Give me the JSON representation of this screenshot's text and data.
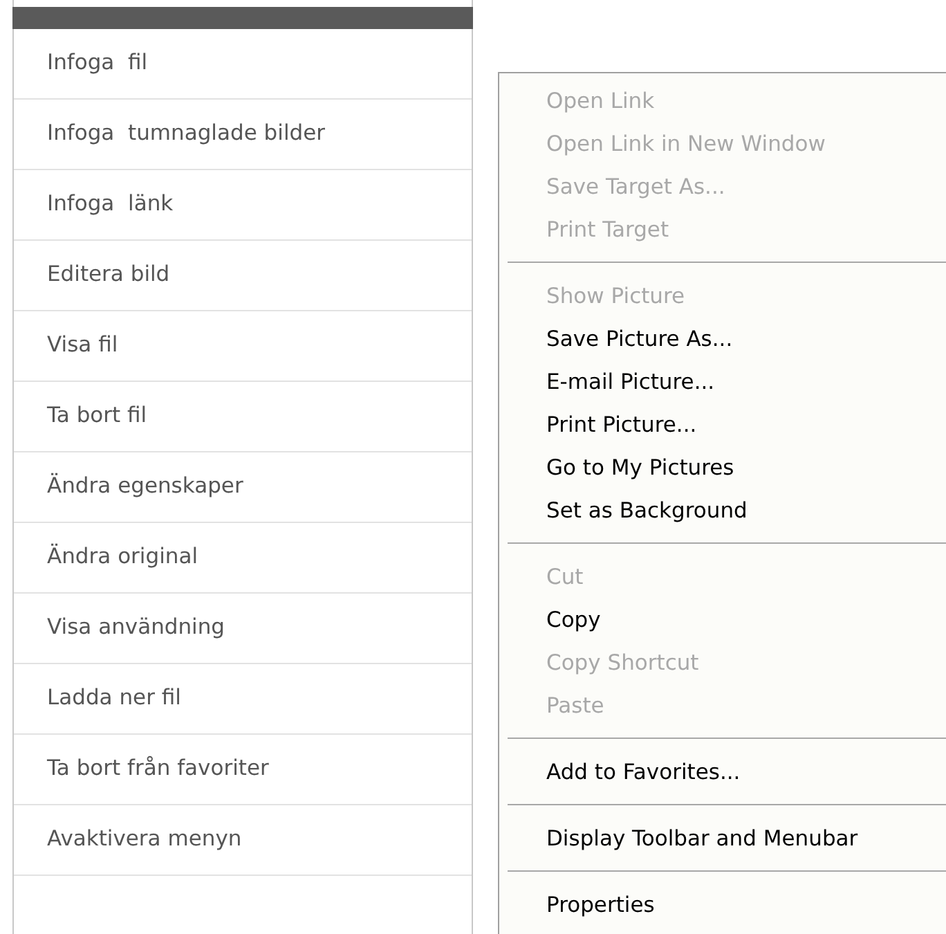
{
  "left_menu": {
    "items": [
      {
        "label": "Infoga  fil"
      },
      {
        "label": "Infoga  tumnaglade bilder"
      },
      {
        "label": "Infoga  länk"
      },
      {
        "label": "Editera bild"
      },
      {
        "label": "Visa fil"
      },
      {
        "label": "Ta bort fil"
      },
      {
        "label": "Ändra egenskaper"
      },
      {
        "label": "Ändra original"
      },
      {
        "label": "Visa användning"
      },
      {
        "label": "Ladda ner fil"
      },
      {
        "label": "Ta bort från favoriter"
      },
      {
        "label": "Avaktivera menyn"
      }
    ]
  },
  "context_menu": {
    "items": [
      {
        "kind": "item",
        "label": "Open Link",
        "disabled": true
      },
      {
        "kind": "item",
        "label": "Open Link in New Window",
        "disabled": true
      },
      {
        "kind": "item",
        "label": "Save Target As...",
        "disabled": true
      },
      {
        "kind": "item",
        "label": "Print Target",
        "disabled": true
      },
      {
        "kind": "separator"
      },
      {
        "kind": "item",
        "label": "Show Picture",
        "disabled": true
      },
      {
        "kind": "item",
        "label": "Save Picture As...",
        "disabled": false
      },
      {
        "kind": "item",
        "label": "E-mail Picture...",
        "disabled": false
      },
      {
        "kind": "item",
        "label": "Print Picture...",
        "disabled": false
      },
      {
        "kind": "item",
        "label": "Go to My Pictures",
        "disabled": false
      },
      {
        "kind": "item",
        "label": "Set as Background",
        "disabled": false
      },
      {
        "kind": "separator"
      },
      {
        "kind": "item",
        "label": "Cut",
        "disabled": true
      },
      {
        "kind": "item",
        "label": "Copy",
        "disabled": false
      },
      {
        "kind": "item",
        "label": "Copy Shortcut",
        "disabled": true
      },
      {
        "kind": "item",
        "label": "Paste",
        "disabled": true
      },
      {
        "kind": "separator"
      },
      {
        "kind": "item",
        "label": "Add to Favorites...",
        "disabled": false
      },
      {
        "kind": "separator"
      },
      {
        "kind": "item",
        "label": "Display Toolbar and Menubar",
        "disabled": false
      },
      {
        "kind": "separator"
      },
      {
        "kind": "item",
        "label": "Properties",
        "disabled": false
      }
    ]
  }
}
